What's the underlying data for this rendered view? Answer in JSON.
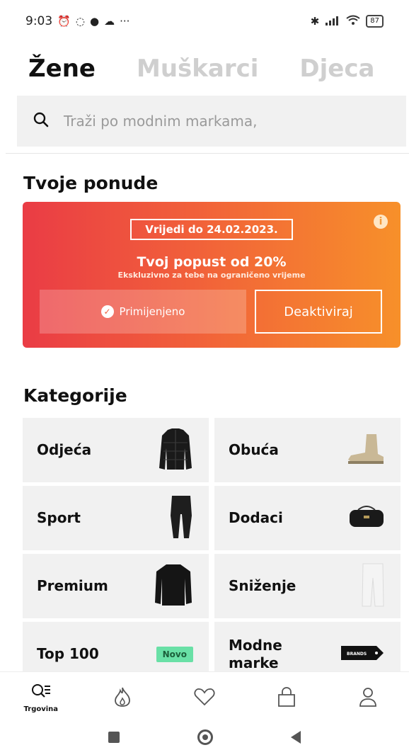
{
  "status_bar": {
    "time": "9:03",
    "left_icons": [
      "alarm-icon",
      "whatsapp-icon",
      "messenger-icon",
      "cloud-icon",
      "more-icon"
    ],
    "right_icons": [
      "bluetooth-icon",
      "signal-icon",
      "wifi-icon",
      "battery-icon"
    ],
    "battery": "87"
  },
  "gender_tabs": [
    {
      "label": "Žene",
      "active": true
    },
    {
      "label": "Muškarci",
      "active": false
    },
    {
      "label": "Djeca",
      "active": false
    }
  ],
  "search": {
    "placeholder": "Traži po modnim markama,"
  },
  "offers": {
    "title": "Tvoje ponude",
    "valid_until": "Vrijedi do 24.02.2023.",
    "discount_title": "Tvoj popust od 20%",
    "discount_sub": "Ekskluzivno za tebe na ograničeno vrijeme",
    "applied_label": "Primijenjeno",
    "deactivate_label": "Deaktiviraj",
    "colors": {
      "start": "#ea3c45",
      "end": "#f7902a"
    }
  },
  "categories": {
    "title": "Kategorije",
    "items": [
      {
        "label": "Odjeća",
        "image": "jacket-image"
      },
      {
        "label": "Obuća",
        "image": "boot-image"
      },
      {
        "label": "Sport",
        "image": "leggings-image"
      },
      {
        "label": "Dodaci",
        "image": "bag-image"
      },
      {
        "label": "Premium",
        "image": "sweater-image"
      },
      {
        "label": "Sniženje",
        "image": "pants-image"
      },
      {
        "label": "Top 100",
        "badge": "Novo"
      },
      {
        "label": "Modne marke",
        "image": "brands-tag-image",
        "tag_text": "BRANDS"
      }
    ]
  },
  "bottom_nav": [
    {
      "label": "Trgovina",
      "icon": "search-list-icon",
      "active": true
    },
    {
      "label": "",
      "icon": "flame-icon"
    },
    {
      "label": "",
      "icon": "heart-icon"
    },
    {
      "label": "",
      "icon": "bag-icon"
    },
    {
      "label": "",
      "icon": "user-icon"
    }
  ]
}
